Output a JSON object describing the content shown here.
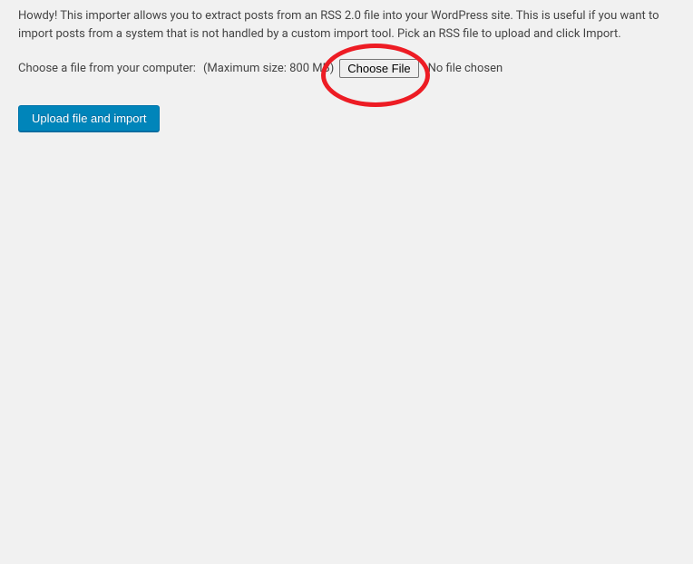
{
  "intro": "Howdy! This importer allows you to extract posts from an RSS 2.0 file into your WordPress site. This is useful if you want to import posts from a system that is not handled by a custom import tool. Pick an RSS file to upload and click Import.",
  "fileRow": {
    "label": "Choose a file from your computer:",
    "maxSize": "(Maximum size: 800 MB)",
    "chooseFileLabel": "Choose File",
    "noFileText": "No file chosen"
  },
  "uploadButtonLabel": "Upload file and import",
  "colors": {
    "primaryButton": "#0085ba",
    "annotation": "#ed1c24"
  }
}
